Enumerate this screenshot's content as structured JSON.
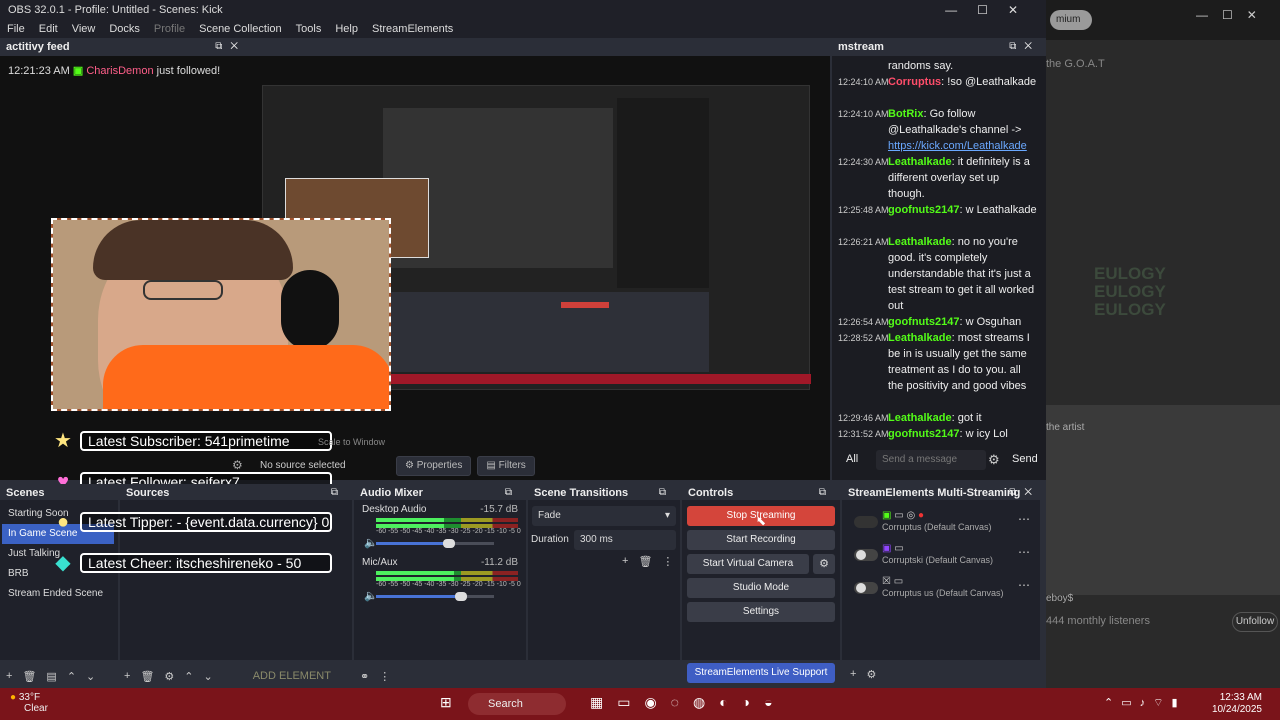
{
  "window": {
    "title": "OBS 32.0.1 - Profile: Untitled - Scenes: Kick",
    "controls": [
      "—",
      "☐",
      "✕"
    ]
  },
  "menu": [
    "File",
    "Edit",
    "View",
    "Docks",
    "Profile",
    "Scene Collection",
    "Tools",
    "Help",
    "StreamElements"
  ],
  "activity_feed": {
    "title": "actitivy feed",
    "time": "12:21:23 AM",
    "user": "CharisDemon",
    "action": "just followed!"
  },
  "overlay": {
    "subscriber": "Latest Subscriber: 541primetime",
    "follower": "Latest Follower: seiferx7",
    "tipper": "Latest Tipper:  - {event.data.currency} 0",
    "cheer": "Latest Cheer: itscheshireneko - 50"
  },
  "preview": {
    "no_source": "No source selected",
    "properties": "Properties",
    "filters": "Filters",
    "transform": "Scale to Window"
  },
  "chat": {
    "title": "mstream",
    "messages": [
      {
        "ts": "",
        "name": "",
        "text": "randoms say."
      },
      {
        "ts": "12:24:10 AM",
        "name": "Corruptus",
        "red": true,
        "text": ": !so @Leathalkade"
      },
      {
        "ts": "12:24:10 AM",
        "name": "BotRix",
        "text": ": Go follow @Leathalkade's channel ->",
        "link": "https://kick.com/Leathalkade"
      },
      {
        "ts": "12:24:30 AM",
        "name": "Leathalkade",
        "text": ": it definitely is a different overlay set up though."
      },
      {
        "ts": "12:25:48 AM",
        "name": "goofnuts2147",
        "text": ": w Leathalkade"
      },
      {
        "ts": "12:26:21 AM",
        "name": "Leathalkade",
        "text": ": no no you're good. it's completely understandable that it's just a test stream to get it all worked out"
      },
      {
        "ts": "12:26:54 AM",
        "name": "goofnuts2147",
        "text": ": w Osguhan"
      },
      {
        "ts": "12:28:52 AM",
        "name": "Leathalkade",
        "text": ": most streams I be in is usually get the same treatment as I do to you. all the positivity and good vibes"
      },
      {
        "ts": "12:29:46 AM",
        "name": "Leathalkade",
        "text": ": got it"
      },
      {
        "ts": "12:31:52 AM",
        "name": "goofnuts2147",
        "text": ": w icy Lol"
      }
    ],
    "channel": "All",
    "input_placeholder": "Send a message",
    "send": "Send"
  },
  "scenes": {
    "title": "Scenes",
    "items": [
      "Starting Soon",
      "In Game Scene",
      "Just Talking",
      "BRB",
      "Stream Ended Scene"
    ],
    "selected": 1
  },
  "sources": {
    "title": "Sources",
    "add_element": "ADD ELEMENT"
  },
  "mixer": {
    "title": "Audio Mixer",
    "channels": [
      {
        "name": "Desktop Audio",
        "db": "-15.7 dB",
        "level": 0.48,
        "volume": 0.62
      },
      {
        "name": "Mic/Aux",
        "db": "-11.2 dB",
        "level": 0.55,
        "volume": 0.72
      }
    ],
    "ticks": "-60 -55 -50 -45 -40 -35 -30 -25 -20 -15 -10 -5 0"
  },
  "transitions": {
    "title": "Scene Transitions",
    "selected": "Fade",
    "duration_label": "Duration",
    "duration": "300 ms"
  },
  "controls": {
    "title": "Controls",
    "stop_streaming": "Stop Streaming",
    "start_recording": "Start Recording",
    "virtual_camera": "Start Virtual Camera",
    "studio_mode": "Studio Mode",
    "settings": "Settings",
    "support": "StreamElements Live Support"
  },
  "multistream": {
    "title": "StreamElements Multi-Streaming",
    "rows": [
      {
        "name": "Corruptus (Default Canvas)",
        "on": false
      },
      {
        "name": "Corruptski (Default Canvas)",
        "on": true
      },
      {
        "name": "Corruptus us (Default Canvas)",
        "on": true
      }
    ]
  },
  "background_app": {
    "premium": "mium",
    "tagline": "the G.O.A.T",
    "eulogy": "EULOGY",
    "artist": "the artist",
    "listeners": "444 monthly listeners",
    "unfollow": "Unfollow",
    "handle": "eboy$"
  },
  "taskbar": {
    "temp": "33°F",
    "condition": "Clear",
    "search": "Search",
    "time": "12:33 AM",
    "date": "10/24/2025"
  },
  "colors": {
    "accent": "#3b62c4",
    "stop": "#d4453b",
    "kick": "#53fc18"
  }
}
